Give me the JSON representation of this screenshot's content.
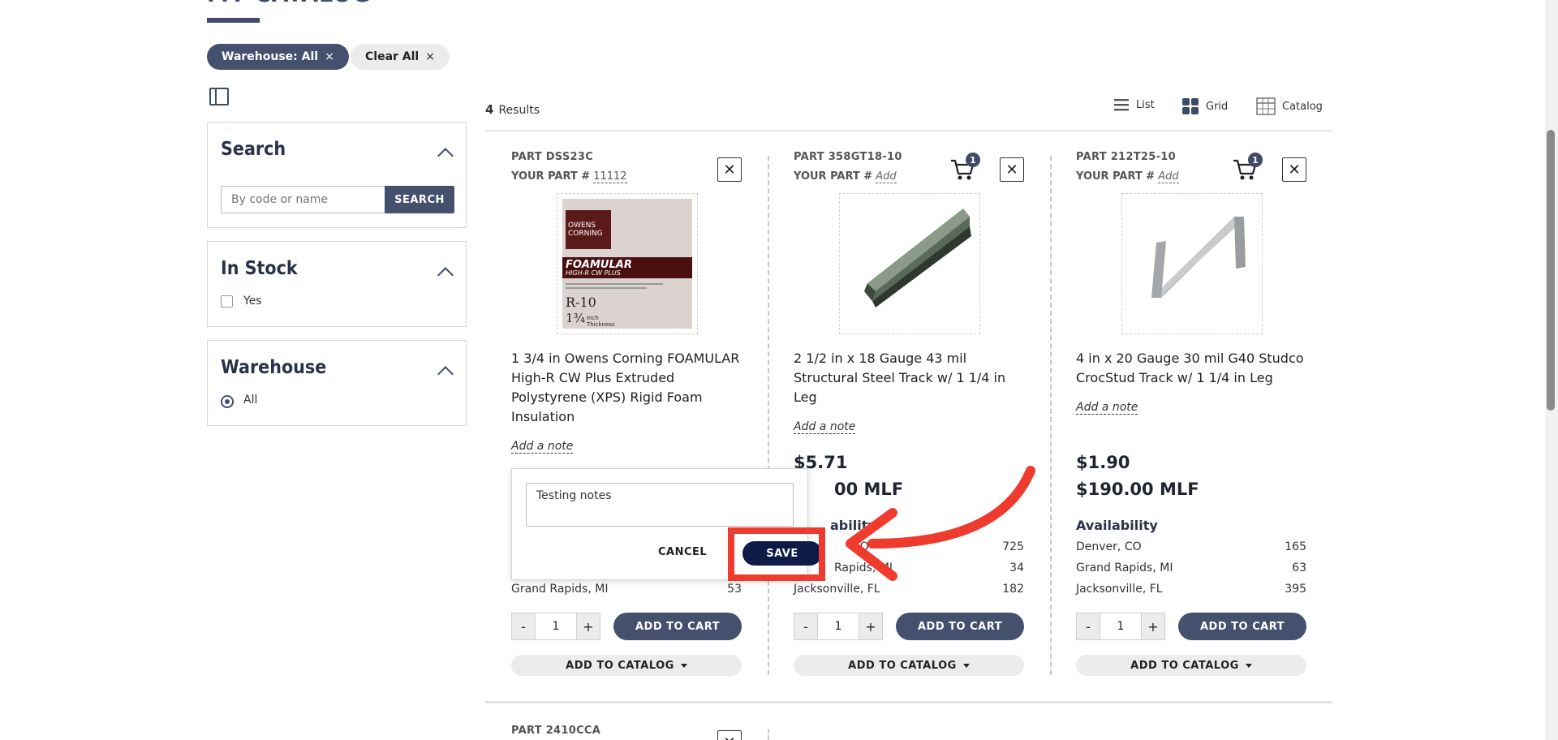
{
  "page": {
    "title": "MY CATALOG"
  },
  "filters": {
    "chips": [
      {
        "label": "Warehouse: All",
        "close": "×"
      },
      {
        "label": "Clear All",
        "close": "×"
      }
    ]
  },
  "sidebar": {
    "search": {
      "title": "Search",
      "placeholder": "By code or name",
      "button": "SEARCH"
    },
    "in_stock": {
      "title": "In Stock",
      "option": "Yes"
    },
    "warehouse": {
      "title": "Warehouse",
      "option": "All"
    }
  },
  "results": {
    "count": "4",
    "label": "Results",
    "views": [
      "List",
      "Grid",
      "Catalog"
    ]
  },
  "products": [
    {
      "part": "PART DSS23C",
      "your_part_label": "YOUR PART #",
      "your_part_value": "11112",
      "description": "1 3/4 in Owens Corning FOAMULAR High-R CW Plus Extruded Polystyrene (XPS) Rigid Foam Insulation",
      "note": "Add a note",
      "availability_row": {
        "location": "Grand Rapids, MI",
        "qty": "53"
      },
      "qty": "1",
      "add_to_cart": "ADD TO CART",
      "add_to_catalog": "ADD TO CATALOG",
      "image_text": {
        "brand1": "OWENS",
        "brand2": "CORNING",
        "product": "FOAMULAR",
        "sub": "HIGH-R CW PLUS",
        "r_value": "R-10",
        "thickness": "1¾",
        "thickness_unit": "Inch Thickness"
      }
    },
    {
      "part": "PART 358GT18-10",
      "your_part_label": "YOUR PART #",
      "your_part_value": "Add",
      "cart_count": "1",
      "description": "2 1/2 in x 18 Gauge 43 mil Structural Steel Track w/ 1 1/4 in Leg",
      "note": "Add a note",
      "price": "$5.71",
      "price_mlf": "00 MLF",
      "availability_title": "ability",
      "availability": [
        {
          "location": "CO",
          "qty": "725"
        },
        {
          "location": "Rapids, MI",
          "qty": "34"
        },
        {
          "location": "Jacksonville, FL",
          "qty": "182"
        }
      ],
      "qty": "1",
      "add_to_cart": "ADD TO CART",
      "add_to_catalog": "ADD TO CATALOG"
    },
    {
      "part": "PART 212T25-10",
      "your_part_label": "YOUR PART #",
      "your_part_value": "Add",
      "cart_count": "1",
      "description": "4 in x 20 Gauge 30 mil G40 Studco CrocStud Track w/ 1 1/4 in Leg",
      "note": "Add a note",
      "price": "$1.90",
      "price_mlf": "$190.00 MLF",
      "availability_title": "Availability",
      "availability": [
        {
          "location": "Denver, CO",
          "qty": "165"
        },
        {
          "location": "Grand Rapids, MI",
          "qty": "63"
        },
        {
          "location": "Jacksonville, FL",
          "qty": "395"
        }
      ],
      "qty": "1",
      "add_to_cart": "ADD TO CART",
      "add_to_catalog": "ADD TO CATALOG"
    }
  ],
  "next_product": {
    "part": "PART 2410CCA"
  },
  "note_popup": {
    "value": "Testing notes",
    "cancel": "CANCEL",
    "save": "SAVE"
  },
  "colors": {
    "primary": "#44506e",
    "save": "#0e1b47",
    "annotation": "#ef3b2d"
  }
}
